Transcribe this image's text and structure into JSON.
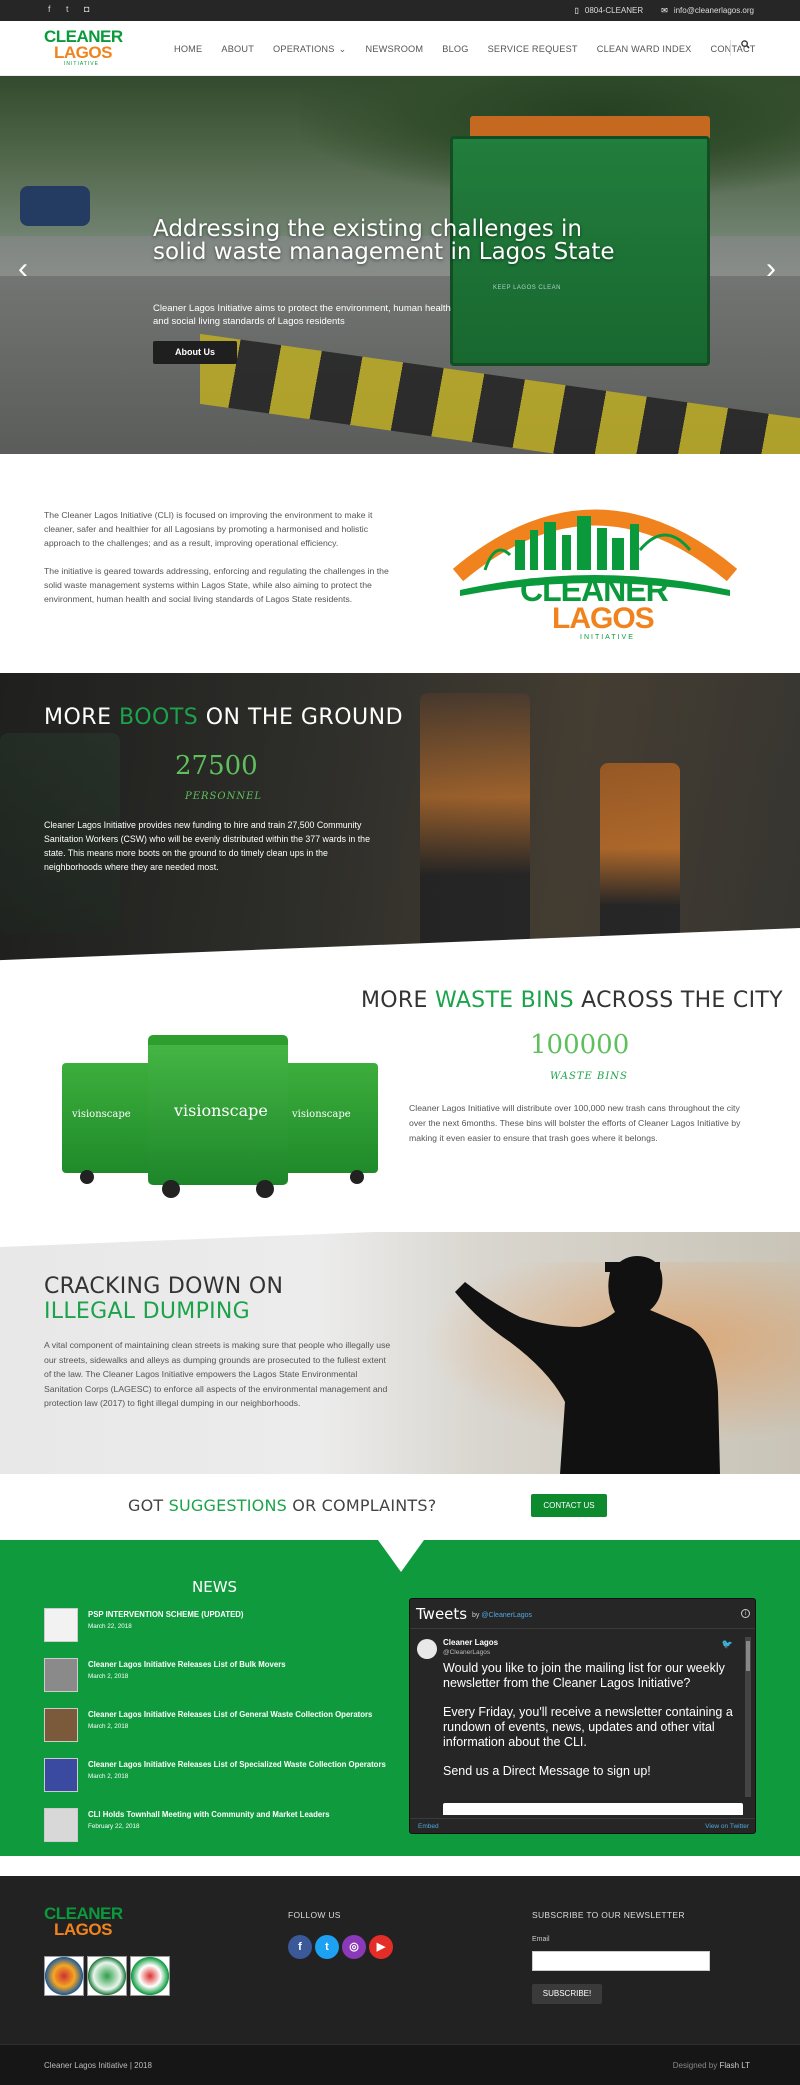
{
  "topbar": {
    "social_icons": [
      "facebook-icon",
      "twitter-icon",
      "instagram-icon"
    ],
    "phone": "0804-CLEANER",
    "email": "info@cleanerlagos.org"
  },
  "logo": {
    "line1": "CLEANER",
    "line2": "LAGOS",
    "line3": "INITIATIVE"
  },
  "nav": {
    "items": [
      "HOME",
      "ABOUT",
      "OPERATIONS",
      "NEWSROOM",
      "BLOG",
      "SERVICE REQUEST",
      "CLEAN WARD INDEX",
      "CONTACT"
    ],
    "operations_caret": "⌄"
  },
  "hero": {
    "title": "Addressing the existing challenges in solid waste management in Lagos State",
    "subtitle": "Cleaner Lagos Initiative aims to protect the environment, human health and social living standards of Lagos residents",
    "button": "About Us",
    "bin_text": "KEEP LAGOS CLEAN"
  },
  "intro": {
    "para1": "The Cleaner Lagos Initiative (CLI) is focused on improving the environment to make it cleaner, safer and healthier for all Lagosians by promoting a harmonised and holistic approach to the challenges; and as a result, improving operational efficiency.",
    "para2": "The initiative is geared towards addressing, enforcing and regulating the challenges in the solid waste management systems within Lagos State, while also aiming to protect the environment, human health and social living standards of Lagos State residents."
  },
  "boots": {
    "title_pre": "MORE ",
    "title_hl": "BOOTS",
    "title_post": " ON THE GROUND",
    "number": "27500",
    "unit": "PERSONNEL",
    "text": "Cleaner Lagos Initiative provides new funding to hire and train 27,500 Community Sanitation Workers (CSW) who will be evenly distributed within the 377 wards in the state. This means more boots on the ground to do timely clean ups in the neighborhoods where they are needed most."
  },
  "bins": {
    "title_pre": "MORE ",
    "title_hl": "WASTE BINS",
    "title_post": " ACROSS THE CITY",
    "number": "100000",
    "unit": "WASTE BINS",
    "text": "Cleaner Lagos Initiative will distribute over 100,000 new trash cans throughout the city over the next 6months. These bins will bolster the efforts of Cleaner Lagos Initiative by making it even easier to ensure that trash goes where it belongs.",
    "bin_brand": "visionscape"
  },
  "dumping": {
    "title_pre": "CRACKING DOWN ON ",
    "title_hl": "ILLEGAL DUMPING",
    "text": "A vital component of maintaining clean streets is making sure that people who illegally use our streets, sidewalks and alleys as dumping grounds are prosecuted to the fullest extent of the law. The Cleaner Lagos Initiative empowers the Lagos State Environmental Sanitation Corps (LAGESC) to enforce all aspects of the environmental management and protection law (2017) to fight illegal dumping in our neighborhoods."
  },
  "suggestions": {
    "pre": "GOT ",
    "hl": "SUGGESTIONS",
    "post": " OR COMPLAINTS?",
    "button": "CONTACT US"
  },
  "news": {
    "heading": "NEWS",
    "items": [
      {
        "title": "PSP INTERVENTION SCHEME (UPDATED)",
        "date": "March 22, 2018"
      },
      {
        "title": "Cleaner Lagos Initiative Releases List of Bulk Movers",
        "date": "March 2, 2018"
      },
      {
        "title": "Cleaner Lagos Initiative Releases List of General Waste Collection Operators",
        "date": "March 2, 2018"
      },
      {
        "title": "Cleaner Lagos Initiative Releases List of Specialized Waste Collection Operators",
        "date": "March 2, 2018"
      },
      {
        "title": "CLI Holds Townhall Meeting with Community and Market Leaders",
        "date": "February 22, 2018"
      }
    ]
  },
  "tweets": {
    "title": "Tweets",
    "by": "by ",
    "handle_link": "@CleanerLagos",
    "name": "Cleaner Lagos",
    "handle": "@CleanerLagos",
    "body1": "Would you like to join the mailing list for our weekly newsletter from the Cleaner Lagos Initiative?",
    "body2": "Every Friday, you'll receive a newsletter containing a rundown of events, news, updates and other vital information about the CLI.",
    "body3": "Send us a Direct Message to sign up!",
    "embed": "Embed",
    "view": "View on Twitter"
  },
  "footer": {
    "follow": "FOLLOW US",
    "subscribe_heading": "SUBSCRIBE TO OUR NEWSLETTER",
    "email_label": "Email",
    "subscribe_button": "SUBSCRIBE!",
    "social": [
      "facebook-icon",
      "twitter-icon",
      "instagram-icon",
      "youtube-icon"
    ],
    "copyright": "Cleaner Lagos Initiative | 2018",
    "designed_pre": "Designed by ",
    "designed_by": "Flash LT"
  },
  "colors": {
    "brand_green": "#0f9b3d",
    "accent_green": "#1ba34a",
    "brand_orange": "#f0831e",
    "dark": "#262626"
  }
}
